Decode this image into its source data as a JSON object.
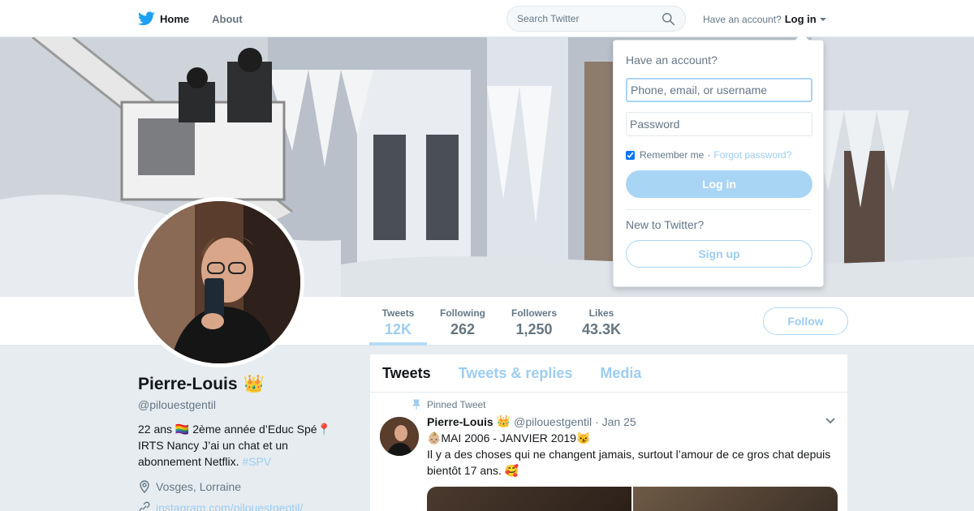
{
  "nav": {
    "home_label": "Home",
    "about_label": "About",
    "search_placeholder": "Search Twitter",
    "have_account_text": "Have an account?",
    "login_link": "Log in"
  },
  "stats": [
    {
      "label": "Tweets",
      "value": "12K"
    },
    {
      "label": "Following",
      "value": "262"
    },
    {
      "label": "Followers",
      "value": "1,250"
    },
    {
      "label": "Likes",
      "value": "43.3K"
    }
  ],
  "follow_label": "Follow",
  "profile": {
    "name": "Pierre-Louis",
    "name_emoji": "👑",
    "handle": "@pilouestgentil",
    "bio": "22 ans 🏳️‍🌈 2ème année d’Educ Spé📍IRTS Nancy J’ai un chat et un abonnement Netflix.",
    "bio_hashtag": "#SPV",
    "location": "Vosges, Lorraine",
    "website": "instagram.com/pilouestgentil/"
  },
  "timeline": {
    "tabs": [
      "Tweets",
      "Tweets & replies",
      "Media"
    ],
    "pinned_label": "Pinned Tweet",
    "tweet": {
      "name": "Pierre-Louis",
      "name_emoji": "👑",
      "handle": "@pilouestgentil",
      "date": "· Jan 25",
      "line1": "👶🏼MAI 2006 - JANVIER 2019😼",
      "line2": "Il y a des choses qui ne changent jamais, surtout l’amour de ce gros chat depuis bientôt 17 ans. 🥰"
    }
  },
  "login_dropdown": {
    "title": "Have an account?",
    "username_placeholder": "Phone, email, or username",
    "password_placeholder": "Password",
    "remember_label": "Remember me",
    "separator": "·",
    "forgot_label": "Forgot password?",
    "login_button": "Log in",
    "new_label": "New to Twitter?",
    "signup_button": "Sign up"
  },
  "colors": {
    "brand_blue": "#1da1f2",
    "light_blue": "#9dcdf1",
    "background": "#e6ecf0"
  }
}
